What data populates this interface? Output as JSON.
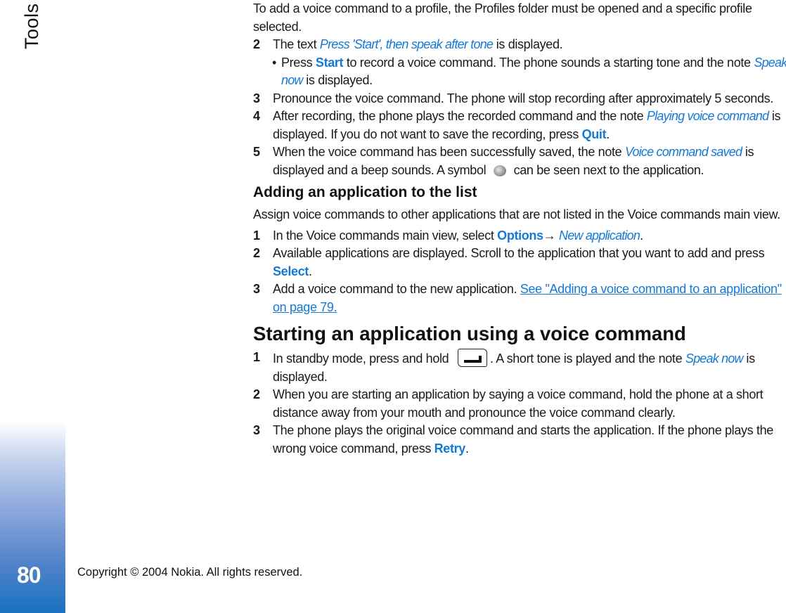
{
  "sidebar": {
    "chapter_title": "Tools",
    "page_number": "80",
    "gradient_color": "#1a72c0"
  },
  "footer": {
    "copyright": "Copyright © 2004 Nokia. All rights reserved."
  },
  "accent_color": "#1479d6",
  "intro": {
    "text": "To add a voice command to a profile, the Profiles folder must be opened and a specific profile selected."
  },
  "recording_steps": [
    {
      "num": "2",
      "pre": "The text ",
      "note": "Press 'Start', then speak after tone",
      "post": " is displayed."
    },
    {
      "bullet": "•",
      "pre": "Press ",
      "key": "Start",
      "mid": " to record a voice command. The phone sounds a starting tone and the note ",
      "note": "Speak now",
      "post": " is displayed."
    },
    {
      "num": "3",
      "text": "Pronounce the voice command. The phone will stop recording after approximately 5 seconds."
    },
    {
      "num": "4",
      "pre": "After recording, the phone plays the recorded command and the note ",
      "note": "Playing voice command",
      "mid": " is displayed. If you do not want to save the recording, press ",
      "key": "Quit",
      "post": "."
    },
    {
      "num": "5",
      "pre": "When the voice command has been successfully saved, the note ",
      "note": "Voice command saved",
      "mid": " is displayed and a beep sounds. A symbol ",
      "icon": "voice-tag-icon",
      "post": " can be seen next to the application."
    }
  ],
  "section_add": {
    "heading": "Adding an application to the list",
    "intro": "Assign voice commands to other applications that are not listed in the Voice commands main view.",
    "steps": [
      {
        "num": "1",
        "pre": "In the Voice commands main view, select ",
        "key": "Options",
        "arrow": "→ ",
        "note": "New application",
        "post": "."
      },
      {
        "num": "2",
        "pre": "Available applications are displayed. Scroll to the application that you want to add and press ",
        "key": "Select",
        "post": "."
      },
      {
        "num": "3",
        "pre": "Add a voice command to the new application. ",
        "link": "See \"Adding a voice command to an application\" on page 79."
      }
    ]
  },
  "section_start": {
    "heading": "Starting an application using a voice command",
    "steps": [
      {
        "num": "1",
        "pre": "In standby mode, press and hold ",
        "icon": "right-selection-key-icon",
        "mid": ". A short tone is played and the note ",
        "note": "Speak now",
        "post": " is displayed."
      },
      {
        "num": "2",
        "text": "When you are starting an application by saying a voice command, hold the phone at a short distance away from your mouth and pronounce the voice command clearly."
      },
      {
        "num": "3",
        "pre": "The phone plays the original voice command and starts the application. If the phone plays the wrong voice command, press ",
        "key": "Retry",
        "post": "."
      }
    ]
  }
}
